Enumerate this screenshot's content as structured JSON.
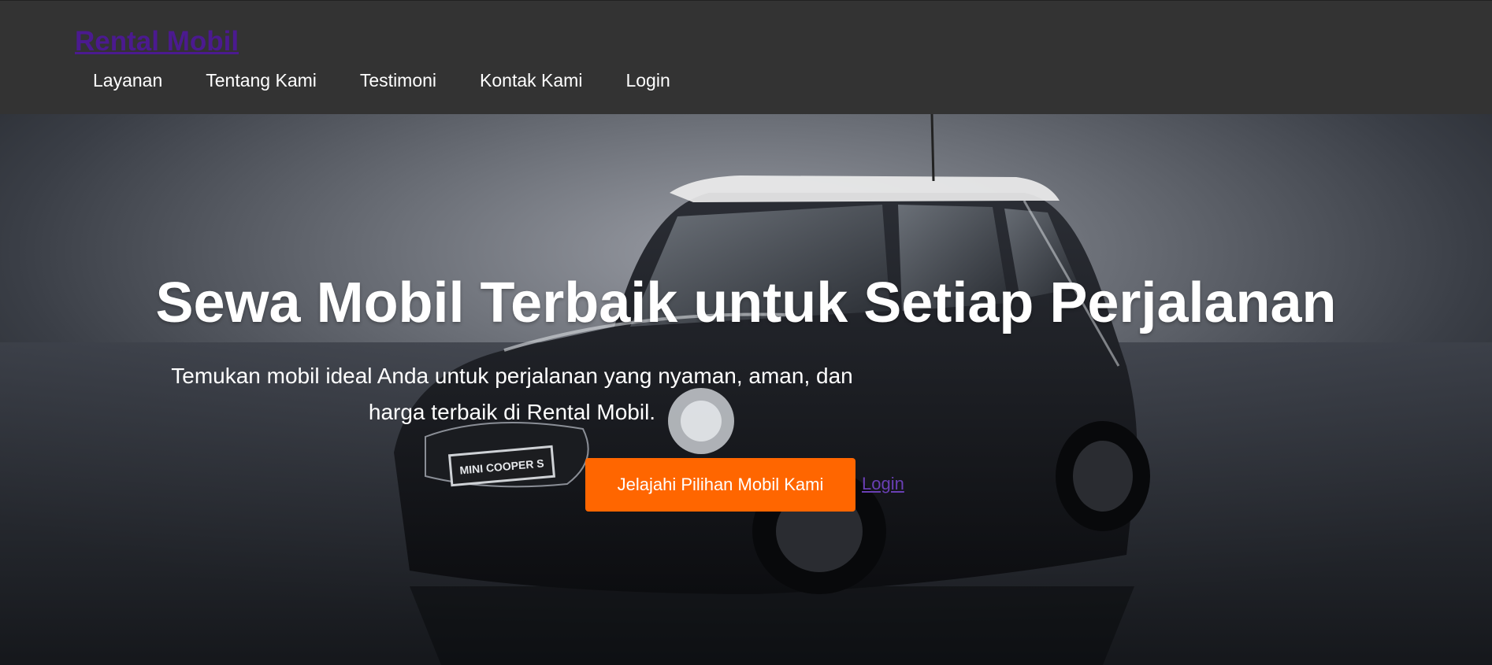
{
  "header": {
    "brand": "Rental Mobil",
    "nav": [
      {
        "label": "Layanan"
      },
      {
        "label": "Tentang Kami"
      },
      {
        "label": "Testimoni"
      },
      {
        "label": "Kontak Kami"
      },
      {
        "label": "Login"
      }
    ]
  },
  "hero": {
    "title": "Sewa Mobil Terbaik untuk Setiap Perjalanan",
    "subtitle": "Temukan mobil ideal Anda untuk perjalanan yang nyaman, aman, dan harga terbaik di Rental Mobil.",
    "cta_label": "Jelajahi Pilihan Mobil Kami",
    "login_link": "Login",
    "plate_text": "MINI COOPER S"
  },
  "colors": {
    "header_bg": "#333333",
    "brand": "#4b1a8f",
    "cta_bg": "#ff6600",
    "link": "#6a3fb5"
  }
}
